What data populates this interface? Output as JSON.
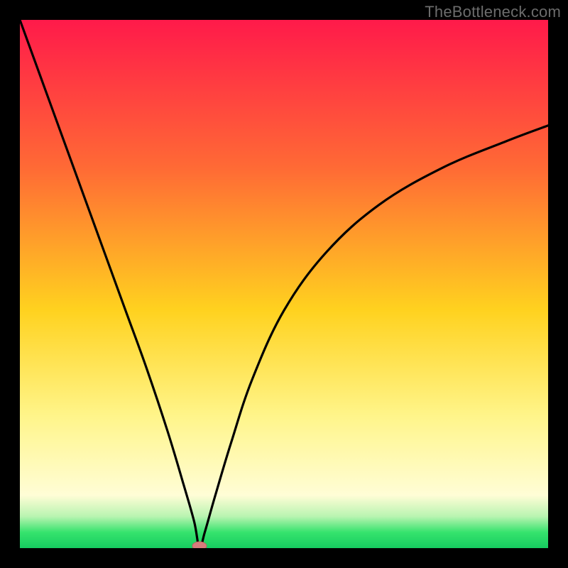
{
  "watermark": "TheBottleneck.com",
  "chart_data": {
    "type": "line",
    "title": "",
    "xlabel": "",
    "ylabel": "",
    "xlim": [
      0,
      100
    ],
    "ylim": [
      0,
      100
    ],
    "min_x": 34,
    "colors": {
      "top": "#ff1a4a",
      "upper_mid": "#ff7a2a",
      "mid": "#ffd21f",
      "lower_mid": "#fff58a",
      "green_mid": "#36e36d",
      "green_low": "#16cc60",
      "frame": "#000000",
      "curve": "#000000",
      "marker_fill": "#d77c7c",
      "marker_stroke": "#c06262"
    },
    "gradient_stops": [
      {
        "offset": 0,
        "color": "#ff1a4a"
      },
      {
        "offset": 28,
        "color": "#ff6a35"
      },
      {
        "offset": 55,
        "color": "#ffd21f"
      },
      {
        "offset": 75,
        "color": "#fff58a"
      },
      {
        "offset": 90,
        "color": "#fffdd6"
      },
      {
        "offset": 94,
        "color": "#b9f4b1"
      },
      {
        "offset": 97,
        "color": "#36e36d"
      },
      {
        "offset": 100,
        "color": "#16cc60"
      }
    ],
    "series": [
      {
        "name": "bottleneck-curve",
        "x": [
          0,
          4,
          8,
          12,
          16,
          20,
          24,
          28,
          31,
          33,
          34,
          35,
          37,
          40,
          44,
          50,
          58,
          68,
          80,
          92,
          100
        ],
        "y": [
          100,
          89,
          78,
          67,
          56,
          45,
          34,
          22,
          12,
          5,
          0,
          3,
          10,
          20,
          32,
          45,
          56,
          65,
          72,
          77,
          80
        ]
      }
    ],
    "marker": {
      "x": 34,
      "y": 0
    }
  }
}
